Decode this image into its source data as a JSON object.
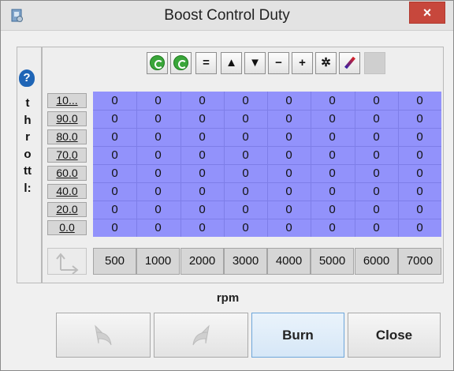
{
  "window": {
    "title": "Boost Control Duty",
    "close_label": "×"
  },
  "side": {
    "help_label": "?",
    "axis_label": "throttl:"
  },
  "toolbar": {
    "equals": "=",
    "up": "▲",
    "down": "▼",
    "minus": "−",
    "plus": "+",
    "multiply": "✲"
  },
  "table": {
    "row_headers": [
      "10...",
      "90.0",
      "80.0",
      "70.0",
      "60.0",
      "40.0",
      "20.0",
      "0.0"
    ],
    "col_headers": [
      "500",
      "1000",
      "2000",
      "3000",
      "4000",
      "5000",
      "6000",
      "7000"
    ],
    "values": [
      [
        "0",
        "0",
        "0",
        "0",
        "0",
        "0",
        "0",
        "0"
      ],
      [
        "0",
        "0",
        "0",
        "0",
        "0",
        "0",
        "0",
        "0"
      ],
      [
        "0",
        "0",
        "0",
        "0",
        "0",
        "0",
        "0",
        "0"
      ],
      [
        "0",
        "0",
        "0",
        "0",
        "0",
        "0",
        "0",
        "0"
      ],
      [
        "0",
        "0",
        "0",
        "0",
        "0",
        "0",
        "0",
        "0"
      ],
      [
        "0",
        "0",
        "0",
        "0",
        "0",
        "0",
        "0",
        "0"
      ],
      [
        "0",
        "0",
        "0",
        "0",
        "0",
        "0",
        "0",
        "0"
      ],
      [
        "0",
        "0",
        "0",
        "0",
        "0",
        "0",
        "0",
        "0"
      ]
    ],
    "x_axis_label": "rpm",
    "cell_color": "#9292fb"
  },
  "buttons": {
    "burn": "Burn",
    "close": "Close"
  }
}
